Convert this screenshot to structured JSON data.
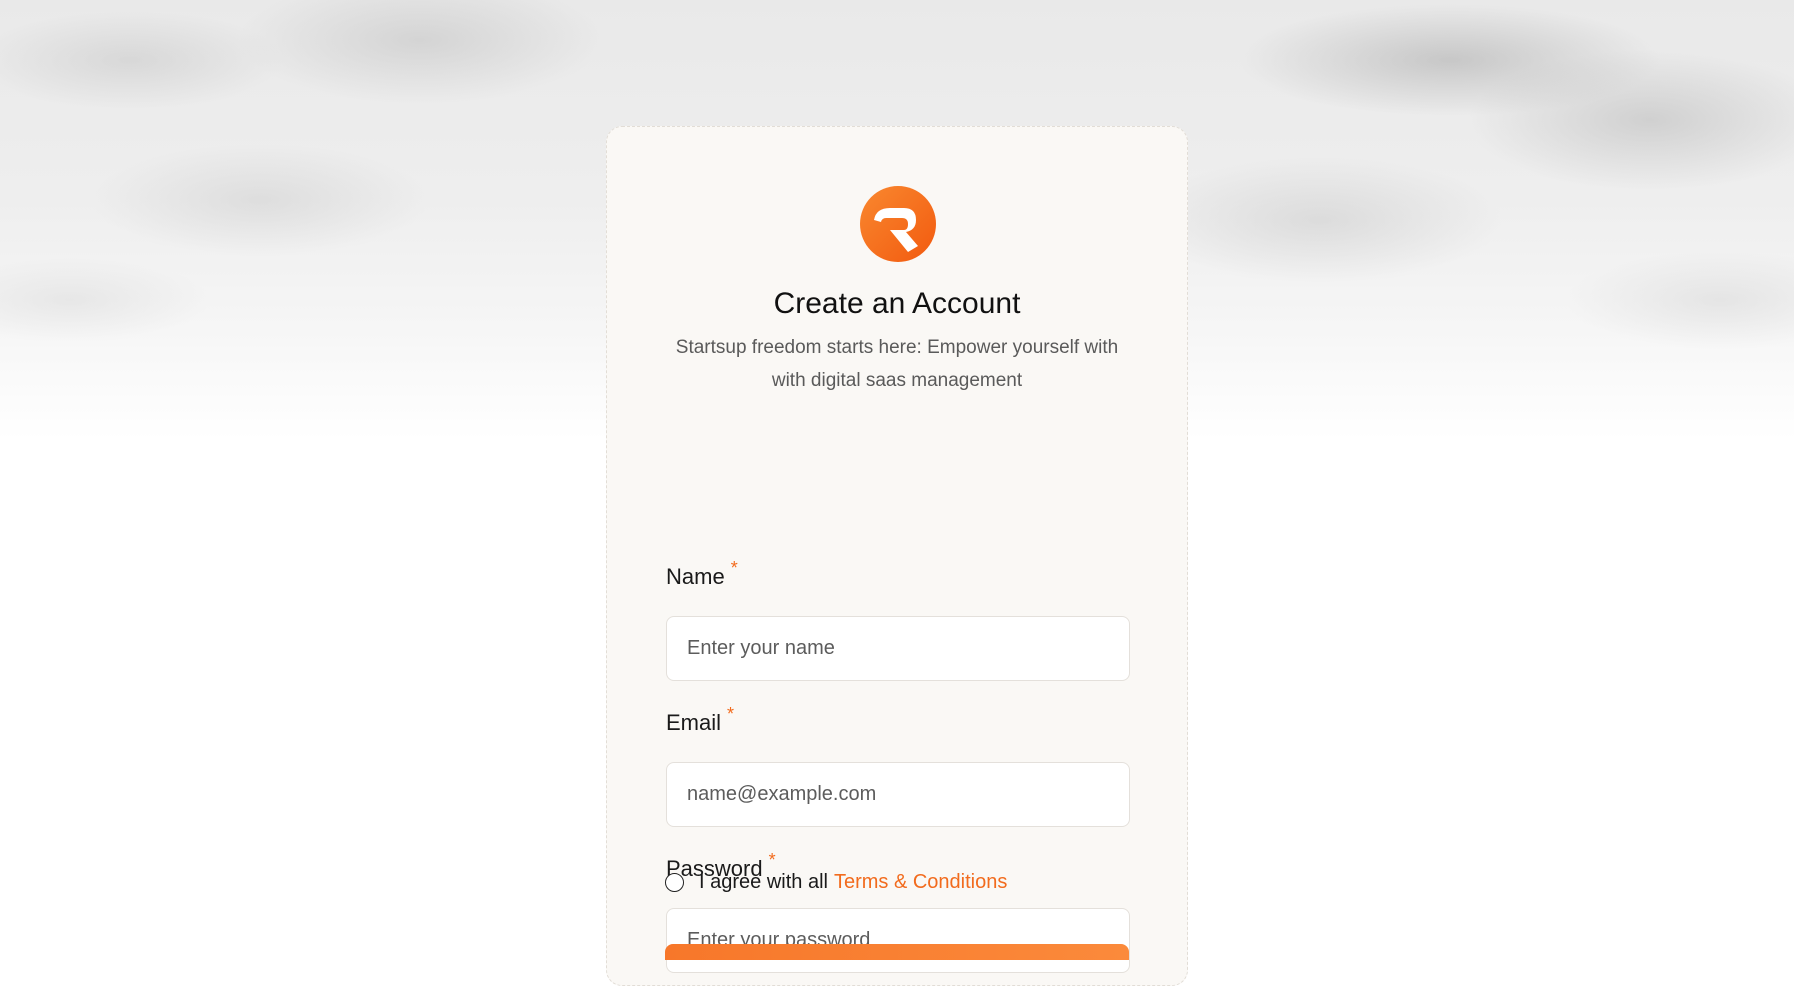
{
  "brand": {
    "logo_icon": "orange-r-logo-icon",
    "accent_color": "#f26b1d"
  },
  "header": {
    "title": "Create an Account",
    "subtitle": "Startsup freedom starts here: Empower yourself with with digital saas management"
  },
  "form": {
    "name": {
      "label": "Name",
      "required_marker": "*",
      "placeholder": "Enter your name"
    },
    "email": {
      "label": "Email",
      "required_marker": "*",
      "placeholder": "name@example.com"
    },
    "password": {
      "label": "Password",
      "required_marker": "*",
      "placeholder": "Enter your password"
    },
    "agreement": {
      "text": "I agree with all",
      "link": "Terms & Conditions",
      "checked": false
    }
  }
}
